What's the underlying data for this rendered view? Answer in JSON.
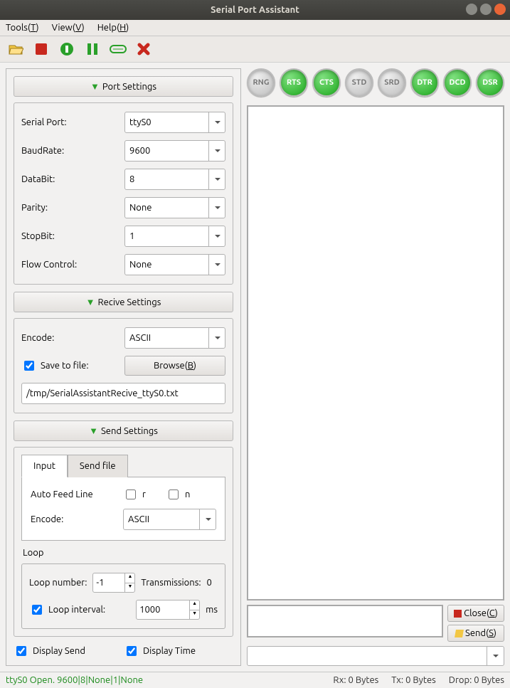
{
  "window": {
    "title": "Serial Port Assistant"
  },
  "menu": {
    "tools": "Tools",
    "tools_u": "T",
    "view": "View",
    "view_u": "V",
    "help": "Help",
    "help_u": "H"
  },
  "sections": {
    "port": "Port Settings",
    "recive": "Recive Settings",
    "send": "Send Settings"
  },
  "port": {
    "serial_label": "Serial Port:",
    "serial_value": "ttyS0",
    "baud_label": "BaudRate:",
    "baud_value": "9600",
    "databit_label": "DataBit:",
    "databit_value": "8",
    "parity_label": "Parity:",
    "parity_value": "None",
    "stopbit_label": "StopBit:",
    "stopbit_value": "1",
    "flow_label": "Flow Control:",
    "flow_value": "None"
  },
  "recive": {
    "encode_label": "Encode:",
    "encode_value": "ASCII",
    "save_label": "Save to file:",
    "browse": "Browse(",
    "browse_u": "B",
    "browse_tail": ")",
    "file_path": "/tmp/SerialAssistantRecive_ttyS0.txt"
  },
  "send": {
    "tab_input": "Input",
    "tab_sendfile": "Send file",
    "autofeed": "Auto Feed Line",
    "r": "r",
    "n": "n",
    "encode_label": "Encode:",
    "encode_value": "ASCII",
    "loop": "Loop",
    "loopnum_label": "Loop number:",
    "loopnum_value": "-1",
    "trans_label": "Transmissions:",
    "trans_value": "0",
    "loopint_label": "Loop interval:",
    "loopint_value": "1000",
    "ms": "ms"
  },
  "display": {
    "send": "Display Send",
    "time": "Display Time"
  },
  "leds": [
    {
      "name": "RNG",
      "state": "off"
    },
    {
      "name": "RTS",
      "state": "on"
    },
    {
      "name": "CTS",
      "state": "on"
    },
    {
      "name": "STD",
      "state": "off"
    },
    {
      "name": "SRD",
      "state": "off"
    },
    {
      "name": "DTR",
      "state": "on"
    },
    {
      "name": "DCD",
      "state": "on"
    },
    {
      "name": "DSR",
      "state": "on"
    }
  ],
  "buttons": {
    "close": "Close(",
    "close_u": "C",
    "close_tail": ")",
    "send": "Send(",
    "send_u": "S",
    "send_tail": ")"
  },
  "statusbar": {
    "status": "ttyS0 Open. 9600|8|None|1|None",
    "rx": "Rx: 0 Bytes",
    "tx": "Tx: 0 Bytes",
    "drop": "Drop: 0 Bytes"
  }
}
